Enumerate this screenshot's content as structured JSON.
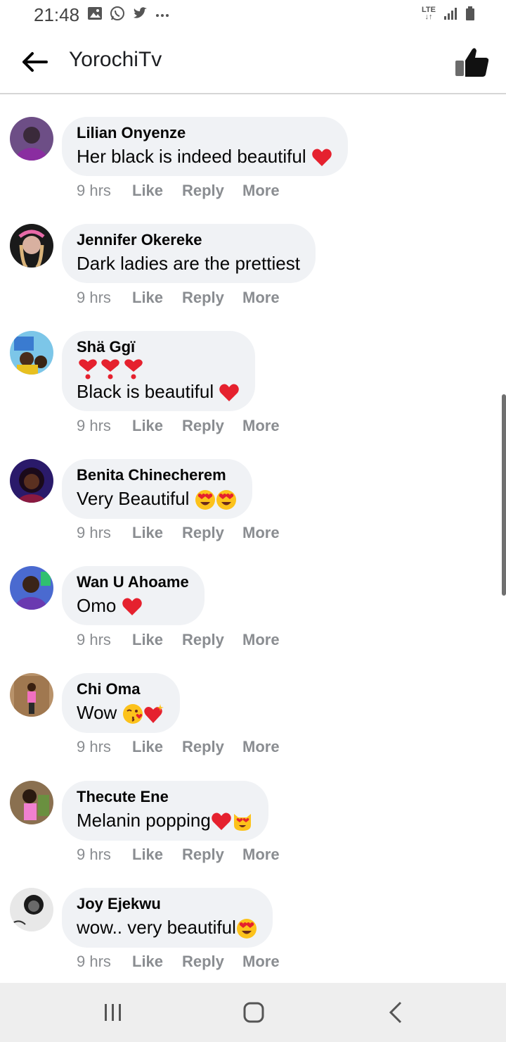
{
  "status_bar": {
    "time": "21:48",
    "network": "LTE"
  },
  "app_bar": {
    "title": "YorochiTv"
  },
  "actions": {
    "like": "Like",
    "reply": "Reply",
    "more": "More"
  },
  "comments": [
    {
      "author": "Lilian Onyenze",
      "text": "Her black is indeed beautiful",
      "time": "9 hrs"
    },
    {
      "author": "Jennifer Okereke",
      "text": "Dark ladies are the prettiest",
      "time": "9 hrs"
    },
    {
      "author": "Shä Ggï",
      "text": "Black is beautiful",
      "time": "9 hrs"
    },
    {
      "author": "Benita Chinecherem",
      "text": "Very Beautiful",
      "time": "9 hrs"
    },
    {
      "author": "Wan U Ahoame",
      "text": "Omo",
      "time": "9 hrs"
    },
    {
      "author": "Chi Oma",
      "text": "Wow",
      "time": "9 hrs"
    },
    {
      "author": "Thecute Ene",
      "text": "Melanin popping",
      "time": "9 hrs"
    },
    {
      "author": "Joy Ejekwu",
      "text": "wow.. very beautiful",
      "time": "9 hrs"
    }
  ],
  "colors": {
    "bubble": "#f0f2f5",
    "meta": "#8a8d91",
    "heart": "#e5212e",
    "navbar": "#eeeeee"
  }
}
